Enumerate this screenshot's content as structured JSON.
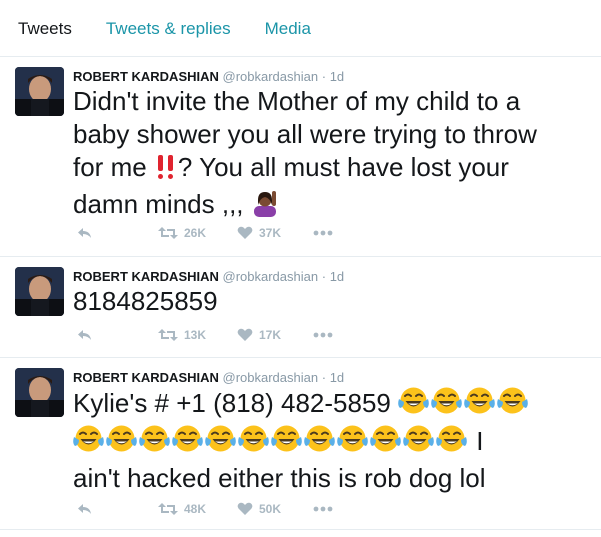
{
  "tabs": [
    {
      "label": "Tweets"
    },
    {
      "label": "Tweets & replies"
    },
    {
      "label": "Media"
    }
  ],
  "tweets": [
    {
      "name": "ROBERT KARDASHIAN",
      "handle": "@robkardashian",
      "sep": "·",
      "time": "1d",
      "lines": [
        "Didn't invite the Mother of my child to a",
        "baby shower you all were trying to throw",
        "for me",
        "? You all must have lost your",
        "damn minds ,,,"
      ],
      "retweets": "26K",
      "likes": "37K"
    },
    {
      "name": "ROBERT KARDASHIAN",
      "handle": "@robkardashian",
      "sep": "·",
      "time": "1d",
      "lines": [
        "8184825859"
      ],
      "retweets": "13K",
      "likes": "17K"
    },
    {
      "name": "ROBERT KARDASHIAN",
      "handle": "@robkardashian",
      "sep": "·",
      "time": "1d",
      "lines": [
        "Kylie's # +1 (818) 482-5859",
        "I",
        "ain't hacked either this is rob dog lol"
      ],
      "retweets": "48K",
      "likes": "50K"
    }
  ],
  "icons": {
    "reply": "reply-icon",
    "retweet": "retweet-icon",
    "like": "heart-icon",
    "more": "more-icon",
    "exclaim": "double-exclamation-emoji",
    "facepalm": "woman-raising-hand-emoji",
    "laugh": "tears-of-joy-emoji"
  },
  "colors": {
    "tab_link": "#1b95a8",
    "action": "#aab8c2",
    "border": "#e6ecf0"
  }
}
